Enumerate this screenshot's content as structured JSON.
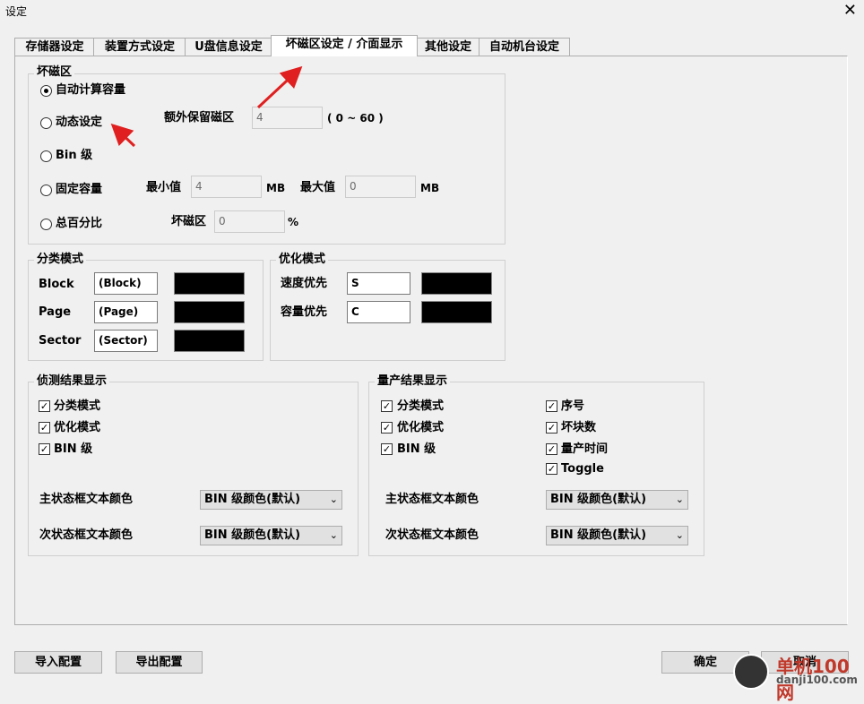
{
  "window": {
    "title": "设定",
    "close_glyph": "✕"
  },
  "tabs": [
    {
      "label": "存储器设定"
    },
    {
      "label": "装置方式设定"
    },
    {
      "label": "U盘信息设定"
    },
    {
      "label": "坏磁区设定 / 介面显示",
      "active": true
    },
    {
      "label": "其他设定"
    },
    {
      "label": "自动机台设定"
    }
  ],
  "bad_block": {
    "title": "坏磁区",
    "options": [
      {
        "label": "自动计算容量",
        "selected": true
      },
      {
        "label": "动态设定",
        "selected": false
      },
      {
        "label": "Bin 级",
        "selected": false
      },
      {
        "label": "固定容量",
        "selected": false
      },
      {
        "label": "总百分比",
        "selected": false
      }
    ],
    "extra_reserve_label": "额外保留磁区",
    "extra_reserve_value": "4",
    "extra_reserve_range": "( 0 ~ 60 )",
    "min_label": "最小值",
    "min_value": "4",
    "min_unit": "MB",
    "max_label": "最大值",
    "max_value": "0",
    "max_unit": "MB",
    "pct_label": "坏磁区",
    "pct_value": "0",
    "pct_unit": "%"
  },
  "classify_mode": {
    "title": "分类模式",
    "rows": [
      {
        "label": "Block",
        "value": "(Block)",
        "color": "#000000"
      },
      {
        "label": "Page",
        "value": "(Page)",
        "color": "#000000"
      },
      {
        "label": "Sector",
        "value": "(Sector)",
        "color": "#000000"
      }
    ]
  },
  "optimize_mode": {
    "title": "优化模式",
    "rows": [
      {
        "label": "速度优先",
        "value": "S",
        "color": "#000000"
      },
      {
        "label": "容量优先",
        "value": "C",
        "color": "#000000"
      }
    ]
  },
  "detect_display": {
    "title": "侦测结果显示",
    "checks": [
      {
        "label": "分类模式",
        "checked": true
      },
      {
        "label": "优化模式",
        "checked": true
      },
      {
        "label": "BIN 级",
        "checked": true
      }
    ],
    "primary_label": "主状态框文本颜色",
    "primary_value": "BIN 级颜色(默认)",
    "secondary_label": "次状态框文本颜色",
    "secondary_value": "BIN 级颜色(默认)"
  },
  "production_display": {
    "title": "量产结果显示",
    "checks_left": [
      {
        "label": "分类模式",
        "checked": true
      },
      {
        "label": "优化模式",
        "checked": true
      },
      {
        "label": "BIN 级",
        "checked": true
      }
    ],
    "checks_right": [
      {
        "label": "序号",
        "checked": true
      },
      {
        "label": "坏块数",
        "checked": true
      },
      {
        "label": "量产时间",
        "checked": true
      },
      {
        "label": "Toggle",
        "checked": true
      }
    ],
    "primary_label": "主状态框文本颜色",
    "primary_value": "BIN 级颜色(默认)",
    "secondary_label": "次状态框文本颜色",
    "secondary_value": "BIN 级颜色(默认)"
  },
  "footer": {
    "import_label": "导入配置",
    "export_label": "导出配置",
    "ok_label": "确定",
    "cancel_label": "取消"
  },
  "watermark": {
    "text1": "单机100网",
    "text2": "danji100.com"
  },
  "annotation_color": "#e02020"
}
